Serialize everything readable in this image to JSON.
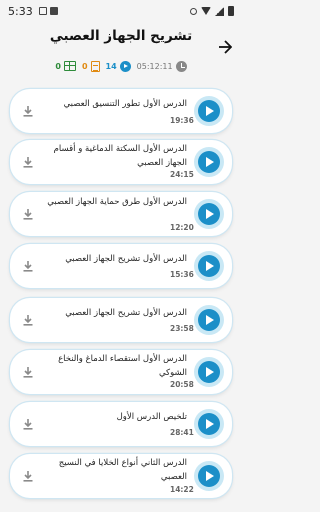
{
  "status_bar": {
    "time": "5:33"
  },
  "header": {
    "title": "تشريح الجهاز العصبي"
  },
  "stats": {
    "tables_count": "0",
    "documents_count": "0",
    "videos_count": "14",
    "total_duration": "05:12:11"
  },
  "lessons": [
    {
      "title": "الدرس الأول تطور التنسيق العصبي",
      "duration": "19:36"
    },
    {
      "title": "الدرس الأول السكتة الدماغية و أقسام الجهاز العصبي",
      "duration": "24:15"
    },
    {
      "title": "الدرس الأول طرق حماية الجهاز العصبي",
      "duration": "12:20"
    },
    {
      "title": "الدرس الأول تشريح الجهاز العصبي",
      "duration": "15:36"
    },
    {
      "title": "الدرس الأول تشريح الجهاز العصبي",
      "duration": "23:58"
    },
    {
      "title": "الدرس الأول استقصاء الدماغ والنخاع الشوكي",
      "duration": "20:58"
    },
    {
      "title": "تلخيص الدرس الأول",
      "duration": "28:41"
    },
    {
      "title": "الدرس الثاني أنواع الخلايا في النسيج العصبي",
      "duration": "14:22"
    }
  ],
  "colors": {
    "accent": "#1b8fc8",
    "green": "#2e8b3a",
    "orange": "#e08a12"
  }
}
